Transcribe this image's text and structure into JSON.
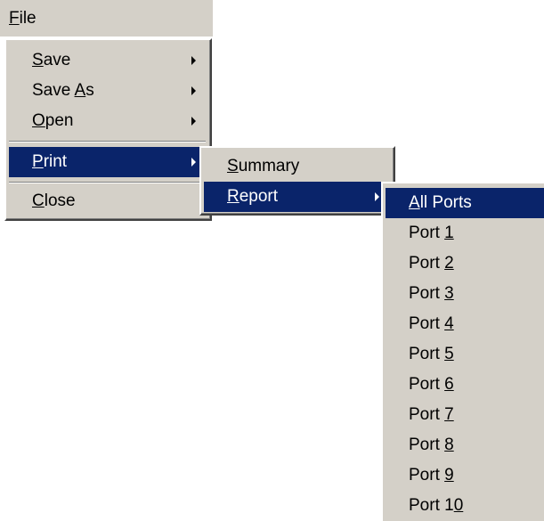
{
  "menubar": {
    "file": {
      "mn": "F",
      "rest": "ile"
    }
  },
  "file_menu": {
    "save": {
      "mn": "S",
      "rest": "ave"
    },
    "save_as": {
      "pre": "Save ",
      "mn": "A",
      "rest": "s"
    },
    "open": {
      "mn": "O",
      "rest": "pen"
    },
    "print": {
      "mn": "P",
      "rest": "rint"
    },
    "close": {
      "mn": "C",
      "rest": "lose"
    }
  },
  "print_menu": {
    "summary": {
      "mn": "S",
      "rest": "ummary"
    },
    "report": {
      "mn": "R",
      "rest": "eport"
    }
  },
  "report_menu": {
    "all_ports": {
      "mn": "A",
      "rest": "ll Ports"
    },
    "ports": [
      {
        "pre": "Port ",
        "mn": "1",
        "rest": ""
      },
      {
        "pre": "Port ",
        "mn": "2",
        "rest": ""
      },
      {
        "pre": "Port ",
        "mn": "3",
        "rest": ""
      },
      {
        "pre": "Port ",
        "mn": "4",
        "rest": ""
      },
      {
        "pre": "Port ",
        "mn": "5",
        "rest": ""
      },
      {
        "pre": "Port ",
        "mn": "6",
        "rest": ""
      },
      {
        "pre": "Port ",
        "mn": "7",
        "rest": ""
      },
      {
        "pre": "Port ",
        "mn": "8",
        "rest": ""
      },
      {
        "pre": "Port ",
        "mn": "9",
        "rest": ""
      },
      {
        "pre": "Port 1",
        "mn": "0",
        "rest": ""
      }
    ]
  },
  "colors": {
    "menu_bg": "#d4d0c8",
    "highlight": "#0a246a",
    "highlight_text": "#ffffff"
  }
}
